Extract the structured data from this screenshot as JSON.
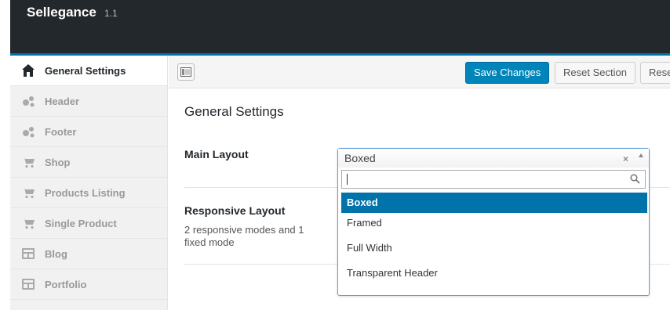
{
  "header": {
    "brand": "Sellegance",
    "version": "1.1"
  },
  "sidebar": {
    "items": [
      {
        "label": "General Settings",
        "icon": "home-icon",
        "active": true
      },
      {
        "label": "Header",
        "icon": "gears-icon"
      },
      {
        "label": "Footer",
        "icon": "gears-icon"
      },
      {
        "label": "Shop",
        "icon": "cart-icon"
      },
      {
        "label": "Products Listing",
        "icon": "cart-icon"
      },
      {
        "label": "Single Product",
        "icon": "cart-icon"
      },
      {
        "label": "Blog",
        "icon": "layout-icon"
      },
      {
        "label": "Portfolio",
        "icon": "layout-icon"
      }
    ]
  },
  "toolbar": {
    "save_label": "Save Changes",
    "reset_section_label": "Reset Section",
    "reset_all_label": "Rese"
  },
  "main": {
    "title": "General Settings",
    "fields": {
      "main_layout": {
        "label": "Main Layout",
        "value": "Boxed"
      },
      "responsive_layout": {
        "label": "Responsive Layout",
        "description": "2 responsive modes and 1 fixed mode"
      }
    }
  },
  "dropdown": {
    "clear": "×",
    "search_value": "",
    "options": [
      "Boxed",
      "Framed",
      "Full Width",
      "Transparent Header"
    ],
    "selected": "Boxed"
  },
  "colors": {
    "header_bg": "#23282d",
    "accent": "#0073aa",
    "primary_button": "#0085ba"
  }
}
